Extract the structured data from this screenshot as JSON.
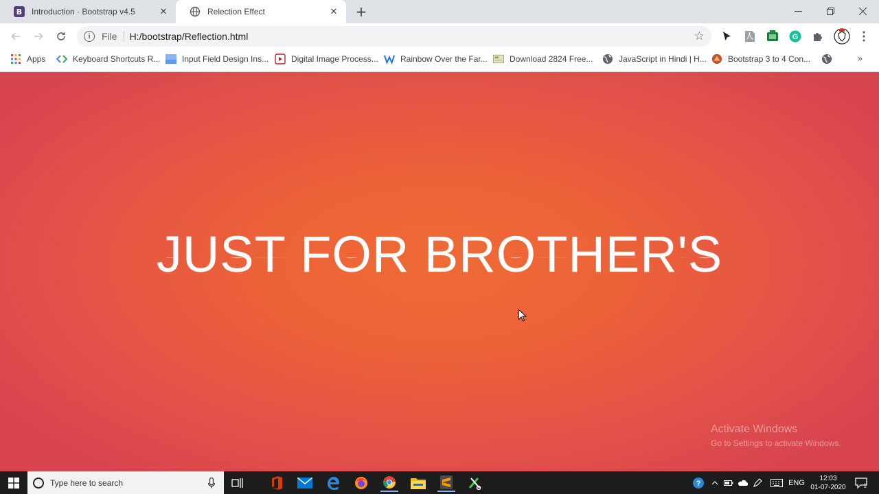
{
  "tabs": [
    {
      "title": "Introduction · Bootstrap v4.5",
      "favicon": "bootstrap-icon",
      "favicon_letter": "B",
      "active": false
    },
    {
      "title": "Relection Effect",
      "favicon": "globe-icon",
      "active": true
    }
  ],
  "address_bar": {
    "scheme_label": "File",
    "url": "H:/bootstrap/Reflection.html"
  },
  "bookmarks": {
    "apps_label": "Apps",
    "items": [
      {
        "label": "Keyboard Shortcuts R...",
        "icon": "code-icon"
      },
      {
        "label": "Input Field Design Ins...",
        "icon": "image-icon"
      },
      {
        "label": "Digital Image Process...",
        "icon": "slides-icon"
      },
      {
        "label": "Rainbow Over the Far...",
        "icon": "w-logo-icon"
      },
      {
        "label": "Download 2824 Free...",
        "icon": "envelope-icon"
      },
      {
        "label": "JavaScript in Hindi | H...",
        "icon": "globe-icon"
      },
      {
        "label": "Bootstrap 3 to 4 Con...",
        "icon": "bootstrap-icon"
      }
    ]
  },
  "page": {
    "headline": "JUST FOR BROTHER'S",
    "watermark_title": "Activate Windows",
    "watermark_sub": "Go to Settings to activate Windows."
  },
  "taskbar": {
    "search_placeholder": "Type here to search",
    "language": "ENG",
    "time": "12:03",
    "date": "01-07-2020",
    "notification_count": "1"
  },
  "colors": {
    "page_center": "#ef6a35",
    "page_edge": "#d8454f",
    "headline": "#ffffff",
    "chrome_frame": "#dee1e6",
    "taskbar": "#1c1c1c"
  }
}
